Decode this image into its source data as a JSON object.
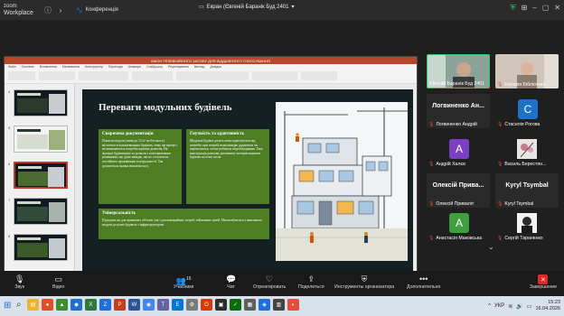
{
  "titlebar": {
    "brand_line1": "zoom",
    "brand_line2": "Workplace",
    "conference_label": "Конференція",
    "screen_tab_label": "Екран (Євгеній Баранік Буд 2401",
    "colors": {
      "shield": "#2ecc71"
    }
  },
  "ppt": {
    "window_title": "ВІКОН ТЕЛЕВІЗІЙНОГО ЗАСОБУ ДЛЯ ВІДДАЛЕНОГО ГОЛОСУВАННЯ",
    "tabs": [
      "Файл",
      "Основне",
      "Вставлення",
      "Малювання",
      "Конструктор",
      "Переходи",
      "Анімація",
      "Слайд-шоу",
      "Рецензування",
      "Вигляд",
      "Довідка"
    ],
    "thumb_numbers": [
      "4",
      "5",
      "6",
      "7",
      "8"
    ],
    "slide": {
      "title": "Переваги модульних будівель",
      "card1_title": "Скорочена документація",
      "card1_text": "Поняття модуля (замів до 12 м² чи без нього) міститься в пояснювальних будівель, тому ще процесі не визначаються потреби окремих дозволів. На значущі будівництво та дозволи з повторюючими рішеннями, що дуже швидко, які не стосуються постійного проживання та нерухомості. Так досягається значна економія часу.",
      "card2_title": "Гнучкість та адаптивність",
      "card2_text": "Модульні будівлі досить легко адаптуються під потреби: при потребі вони швидко додаються чи переносяться, легше робиться переобладнання. Така конструкція дозволяє доповнити чи перепланувати будівлю на етапі після.",
      "card3_title": "Універсальність",
      "card3_text": "Підходить як для приватних об'єктів, так і для комерційних потреб, військових цілей. Масштабуються з невеликого модуля до цілих будівель з інфраструктурою."
    }
  },
  "gallery": {
    "participants": [
      {
        "name": "Євгеній Баранік Буд 2401",
        "type": "video",
        "muted": false
      },
      {
        "name": "Наталія Бібліотека",
        "type": "video",
        "muted": true
      },
      {
        "name": "Логвиненко Андрій",
        "big": "Логвиненко Ан...",
        "type": "name",
        "muted": true
      },
      {
        "name": "Стаселія Рогова",
        "letter": "C",
        "type": "avatar",
        "color": "#1e73c8",
        "muted": true
      },
      {
        "name": "Андрій Халєв",
        "letter": "A",
        "type": "avatar",
        "color": "#7b3fc4",
        "muted": true
      },
      {
        "name": "Василь Берестян...",
        "type": "photo",
        "muted": true
      },
      {
        "name": "Олексій Приваліт",
        "big": "Олексій Прива...",
        "type": "name",
        "muted": true
      },
      {
        "name": "Kyryl Tsymbal",
        "big": "Kyryl Tsymbal",
        "type": "name",
        "muted": true
      },
      {
        "name": "Анастасія Маковська",
        "letter": "A",
        "type": "avatar",
        "color": "#3f9f3f",
        "muted": true
      },
      {
        "name": "Сергій Тараненко",
        "type": "photo2",
        "muted": true
      }
    ]
  },
  "toolbar": {
    "audio": "Звук",
    "video": "Відео",
    "participants": "Учасники",
    "participants_count": "15",
    "chat": "Чат",
    "react": "Отреагировать",
    "share": "Поделиться",
    "host_tools": "Инструменты организатора",
    "more": "Дополнительно",
    "end": "Завершение"
  },
  "taskbar": {
    "lang": "УКР",
    "time": "15:23",
    "date": "16.04.2026"
  }
}
